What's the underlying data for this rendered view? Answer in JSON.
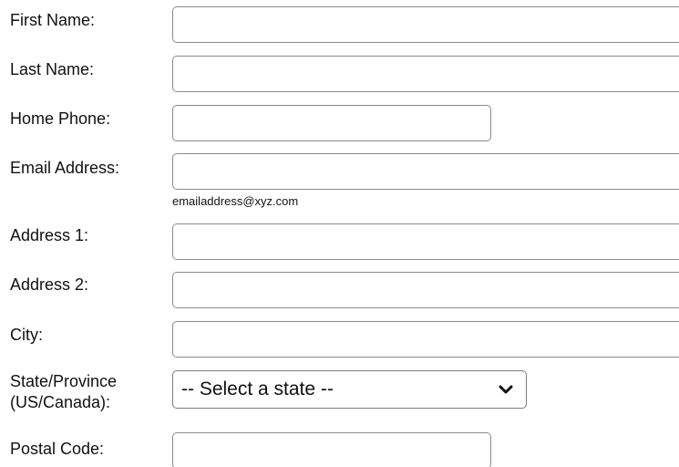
{
  "form": {
    "first_name": {
      "label": "First Name:",
      "value": ""
    },
    "last_name": {
      "label": "Last Name:",
      "value": ""
    },
    "home_phone": {
      "label": "Home Phone:",
      "value": ""
    },
    "email": {
      "label": "Email Address:",
      "value": "",
      "hint": "emailaddress@xyz.com"
    },
    "address1": {
      "label": "Address 1:",
      "value": ""
    },
    "address2": {
      "label": "Address 2:",
      "value": ""
    },
    "city": {
      "label": "City:",
      "value": ""
    },
    "state": {
      "label_line1": "State/Province",
      "label_line2": "(US/Canada):",
      "selected": "-- Select a state --",
      "icon": "chevron-down-icon"
    },
    "postal_code": {
      "label": "Postal Code:",
      "value": ""
    }
  }
}
